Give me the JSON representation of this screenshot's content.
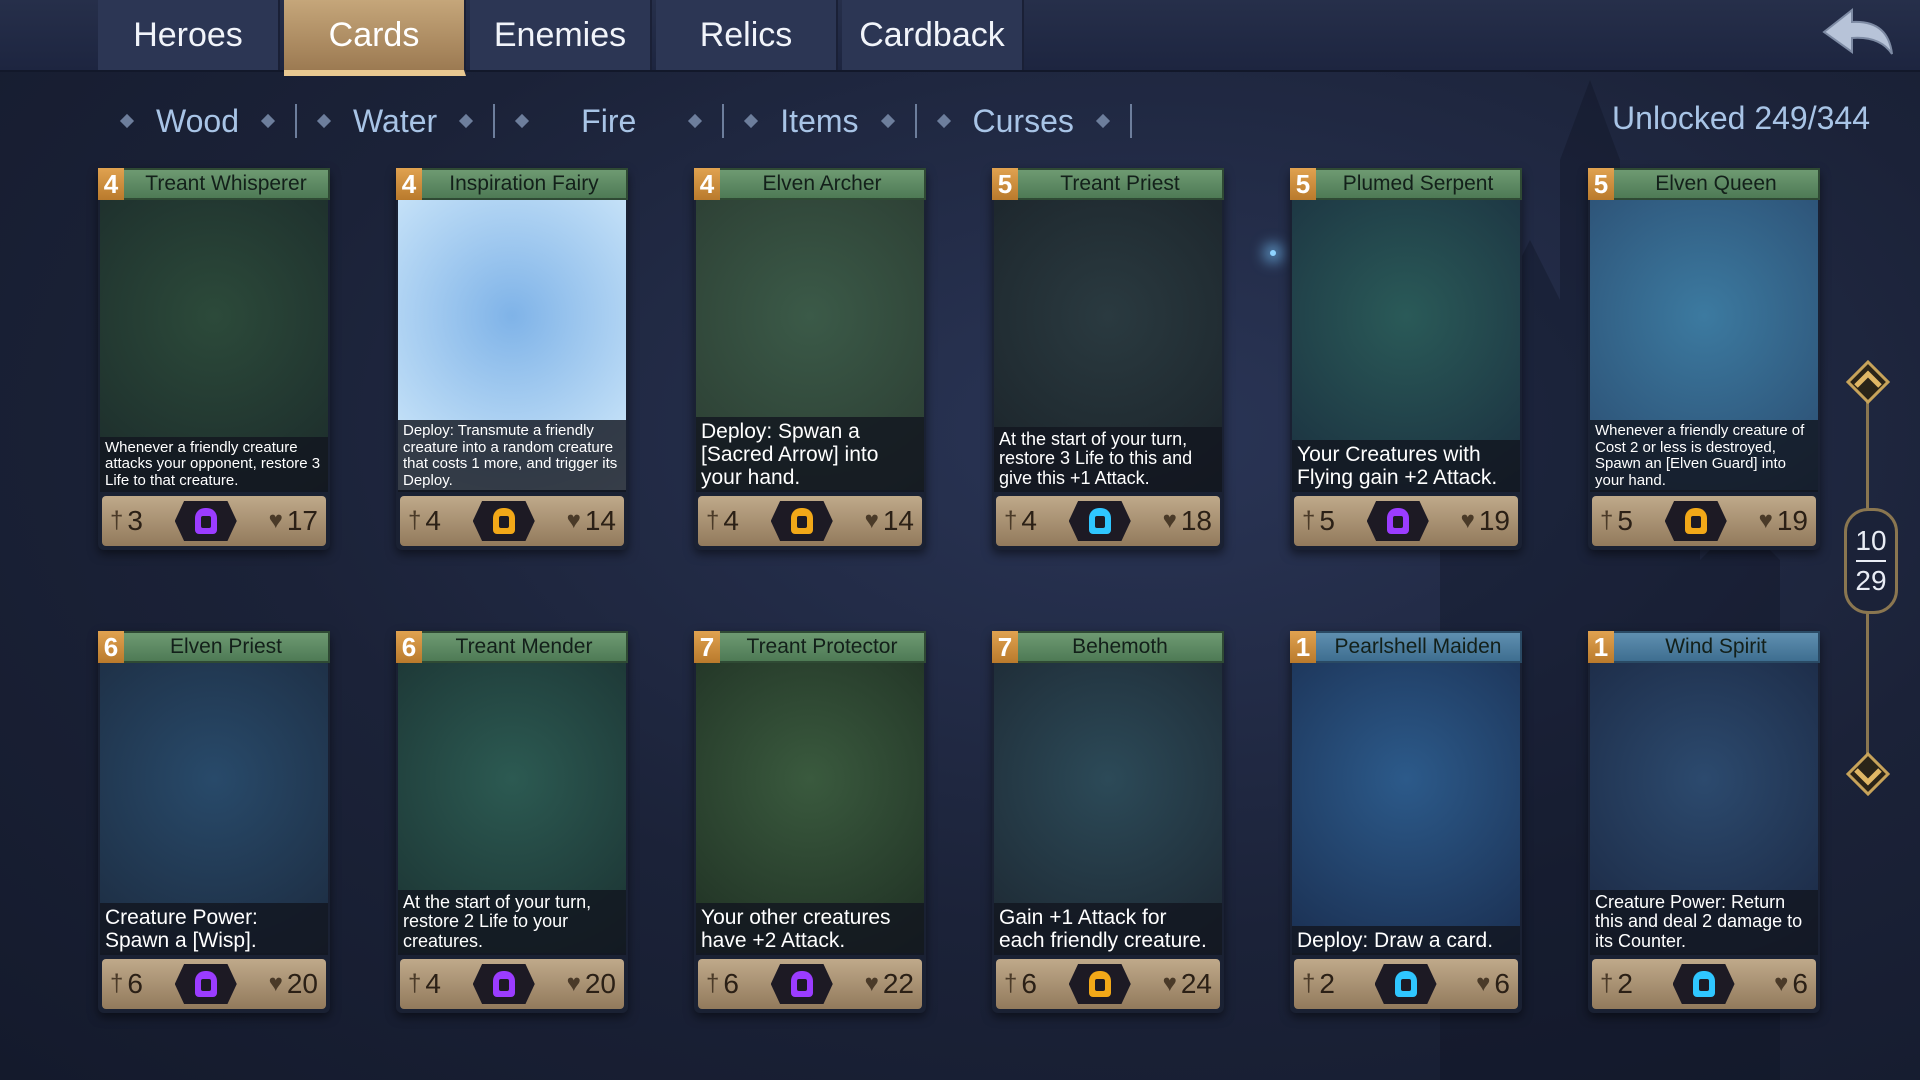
{
  "tabs": [
    "Heroes",
    "Cards",
    "Enemies",
    "Relics",
    "Cardback"
  ],
  "active_tab": "Cards",
  "filters": [
    "Wood",
    "Water",
    "Fire",
    "Items",
    "Curses"
  ],
  "unlocked_label": "Unlocked 249/344",
  "pager": {
    "current": "10",
    "total": "29"
  },
  "colors": {
    "purple": "#9b3cff",
    "gold": "#f2a818",
    "cyan": "#2fc6ff",
    "wood_title": "#6e9a72",
    "water_title": "#5f8fb0"
  },
  "cards": [
    {
      "cost": "4",
      "name": "Treant Whisperer",
      "desc": "Whenever a friendly creature attacks your opponent, restore 3 Life to that creature.",
      "attack": "3",
      "health": "17",
      "rarity": "purple",
      "element": "wood"
    },
    {
      "cost": "4",
      "name": "Inspiration Fairy",
      "desc": "Deploy: Transmute a friendly creature into a random creature that costs 1 more, and trigger its Deploy.",
      "attack": "4",
      "health": "14",
      "rarity": "gold",
      "element": "wood"
    },
    {
      "cost": "4",
      "name": "Elven Archer",
      "desc": "Deploy: Spwan a [Sacred Arrow] into your hand.",
      "attack": "4",
      "health": "14",
      "rarity": "gold",
      "element": "wood"
    },
    {
      "cost": "5",
      "name": "Treant Priest",
      "desc": "At the start of your turn, restore 3 Life to this and give this +1 Attack.",
      "attack": "4",
      "health": "18",
      "rarity": "cyan",
      "element": "wood"
    },
    {
      "cost": "5",
      "name": "Plumed Serpent",
      "desc": "Your Creatures with Flying gain +2 Attack.",
      "attack": "5",
      "health": "19",
      "rarity": "purple",
      "element": "wood"
    },
    {
      "cost": "5",
      "name": "Elven Queen",
      "desc": "Whenever a friendly creature of Cost 2 or less is destroyed, Spawn an [Elven Guard] into your hand.",
      "attack": "5",
      "health": "19",
      "rarity": "gold",
      "element": "wood"
    },
    {
      "cost": "6",
      "name": "Elven Priest",
      "desc": "Creature Power: Spawn a [Wisp].",
      "attack": "6",
      "health": "20",
      "rarity": "purple",
      "element": "wood"
    },
    {
      "cost": "6",
      "name": "Treant Mender",
      "desc": "At the start of your turn, restore 2 Life to your creatures.",
      "attack": "4",
      "health": "20",
      "rarity": "purple",
      "element": "wood"
    },
    {
      "cost": "7",
      "name": "Treant Protector",
      "desc": "Your other creatures have +2 Attack.",
      "attack": "6",
      "health": "22",
      "rarity": "purple",
      "element": "wood"
    },
    {
      "cost": "7",
      "name": "Behemoth",
      "desc": "Gain +1 Attack for each friendly creature.",
      "attack": "6",
      "health": "24",
      "rarity": "gold",
      "element": "wood"
    },
    {
      "cost": "1",
      "name": "Pearlshell Maiden",
      "desc": "Deploy: Draw a card.",
      "attack": "2",
      "health": "6",
      "rarity": "cyan",
      "element": "water"
    },
    {
      "cost": "1",
      "name": "Wind Spirit",
      "desc": "Creature Power: Return this and deal 2 damage to its Counter.",
      "attack": "2",
      "health": "6",
      "rarity": "cyan",
      "element": "water"
    }
  ]
}
